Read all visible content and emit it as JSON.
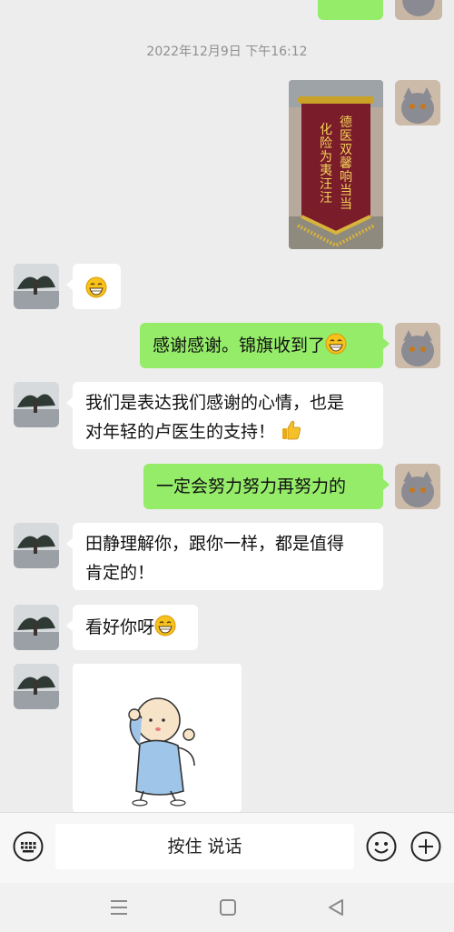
{
  "chat": {
    "timestamp": "2022年12月9日 下午16:12",
    "messages": [
      {
        "side": "right",
        "type": "image",
        "content": "锦旗照片"
      },
      {
        "side": "left",
        "type": "emoji",
        "emoji": "grin-emoji"
      },
      {
        "side": "right",
        "type": "text",
        "text": "感谢感谢。锦旗收到了",
        "trailing_emoji": "grin-emoji"
      },
      {
        "side": "left",
        "type": "text",
        "lines": [
          "我们是表达我们感谢的心情，也是",
          "对年轻的卢医生的支持！"
        ],
        "trailing_emoji": "thumbs-up-emoji"
      },
      {
        "side": "right",
        "type": "text",
        "text": "一定会努力努力再努力的"
      },
      {
        "side": "left",
        "type": "text",
        "lines": [
          "田静理解你，跟你一样，都是值得",
          "肯定的！"
        ]
      },
      {
        "side": "left",
        "type": "text",
        "text": "看好你呀",
        "trailing_emoji": "grin-emoji"
      },
      {
        "side": "left",
        "type": "sticker",
        "sticker": "little-monk-sticker"
      }
    ],
    "banner_text": {
      "left_col": "化险为夷汪汪",
      "right_col": "德医双馨响当当"
    }
  },
  "input_bar": {
    "hold_to_talk": "按住 说话",
    "icons": [
      "keyboard-icon",
      "emoji-icon",
      "plus-icon"
    ]
  },
  "system_nav": {
    "icons": [
      "menu-icon",
      "home-icon",
      "back-icon"
    ]
  },
  "colors": {
    "background": "#ededed",
    "sent_bubble": "#95ec69",
    "received_bubble": "#ffffff",
    "timestamp": "#8f8f8f"
  }
}
